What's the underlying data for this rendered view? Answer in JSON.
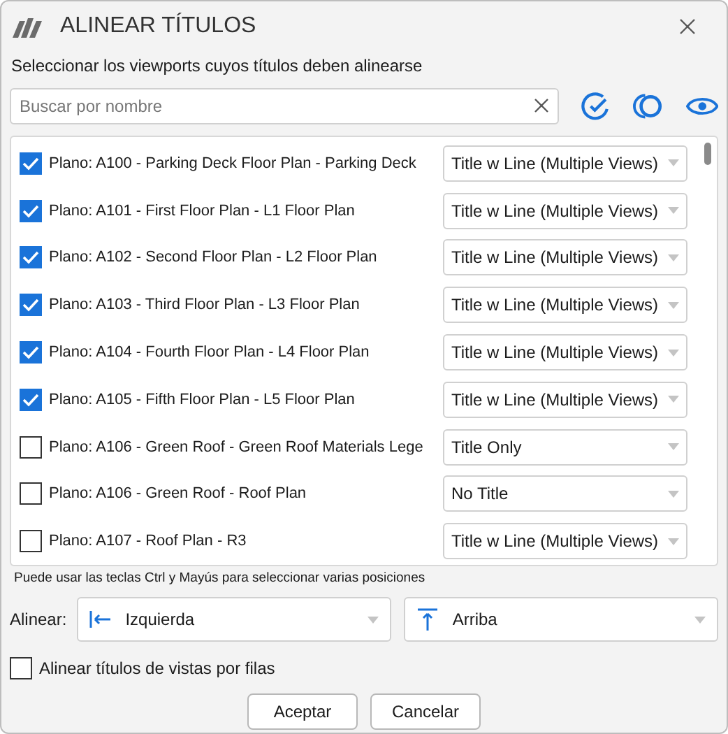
{
  "window": {
    "title": "ALINEAR TÍTULOS"
  },
  "instruction": "Seleccionar los viewports cuyos títulos deben alinearse",
  "search": {
    "placeholder": "Buscar por nombre"
  },
  "viewports": [
    {
      "label": "Plano: A100 - Parking Deck Floor Plan - Parking Deck",
      "checked": true,
      "title_type": "Title w Line (Multiple Views)"
    },
    {
      "label": "Plano: A101 - First Floor Plan - L1 Floor Plan",
      "checked": true,
      "title_type": "Title w Line (Multiple Views)"
    },
    {
      "label": "Plano: A102 - Second Floor Plan - L2 Floor Plan",
      "checked": true,
      "title_type": "Title w Line (Multiple Views)"
    },
    {
      "label": "Plano: A103 - Third Floor Plan - L3 Floor Plan",
      "checked": true,
      "title_type": "Title w Line (Multiple Views)"
    },
    {
      "label": "Plano: A104 - Fourth Floor Plan - L4 Floor Plan",
      "checked": true,
      "title_type": "Title w Line (Multiple Views)"
    },
    {
      "label": "Plano: A105 - Fifth Floor Plan - L5 Floor Plan",
      "checked": true,
      "title_type": "Title w Line (Multiple Views)"
    },
    {
      "label": "Plano: A106 - Green Roof - Green Roof Materials Lege",
      "checked": false,
      "title_type": "Title Only"
    },
    {
      "label": "Plano: A106 - Green Roof - Roof Plan",
      "checked": false,
      "title_type": "No Title"
    },
    {
      "label": "Plano: A107 - Roof Plan - R3",
      "checked": false,
      "title_type": "Title w Line (Multiple Views)"
    }
  ],
  "hint": "Puede usar las teclas Ctrl y Mayús para seleccionar varias posiciones",
  "align": {
    "label": "Alinear:",
    "horizontal": "Izquierda",
    "vertical": "Arriba"
  },
  "align_by_rows": {
    "label": "Alinear títulos de vistas por filas",
    "checked": false
  },
  "buttons": [
    "Aceptar",
    "Cancelar"
  ]
}
